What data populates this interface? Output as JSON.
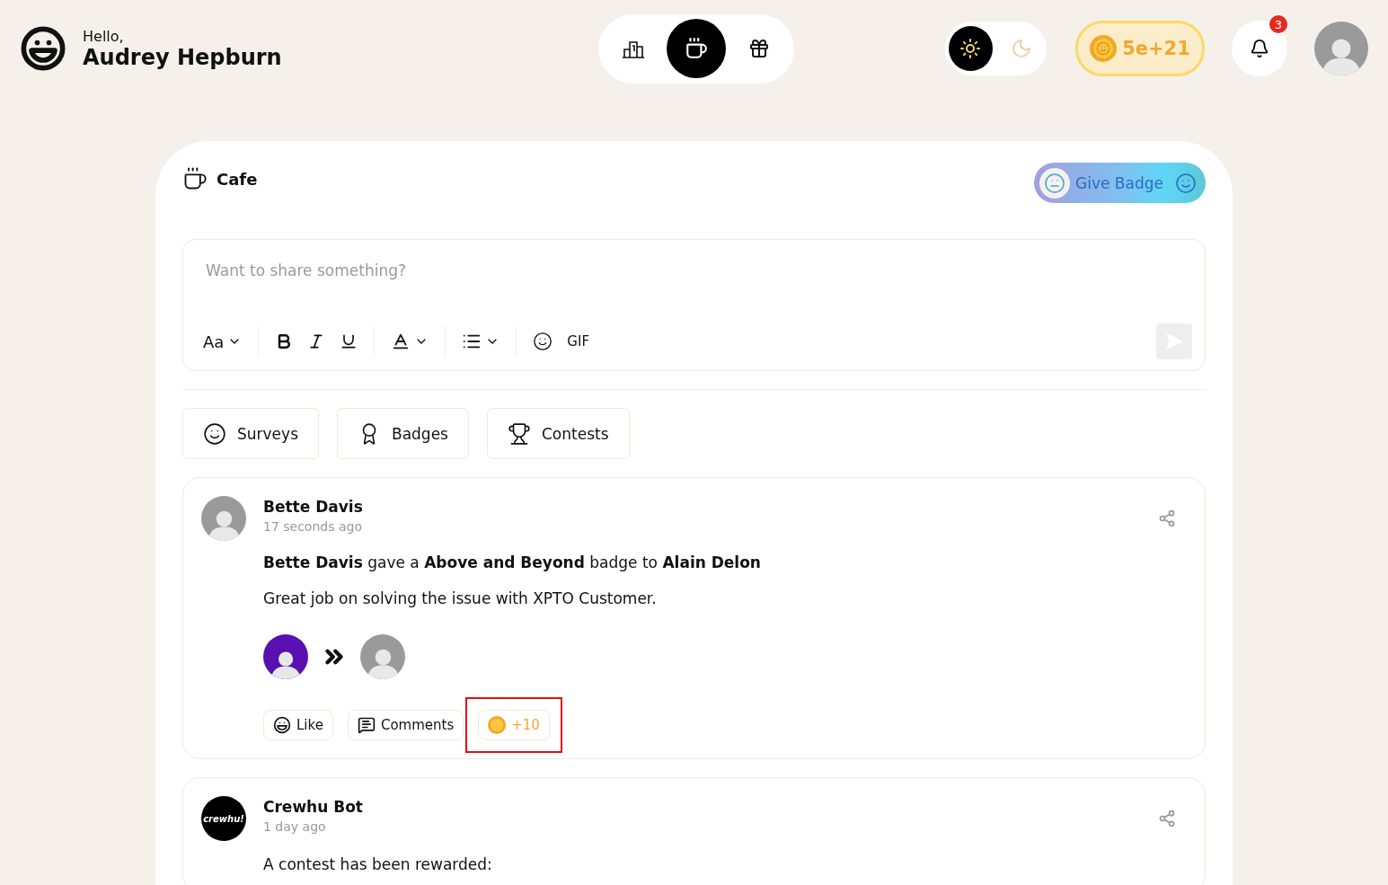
{
  "header": {
    "greeting": "Hello,",
    "user_name": "Audrey Hepburn",
    "nav": [
      {
        "kind": "leaderboard",
        "selected": false
      },
      {
        "kind": "cafe",
        "selected": true
      },
      {
        "kind": "rewards",
        "selected": false
      }
    ],
    "theme_toggle": [
      {
        "kind": "light",
        "selected": true
      },
      {
        "kind": "dark",
        "selected": false
      }
    ],
    "coins": "5e+21",
    "notifications": "3"
  },
  "feed": {
    "title": "Cafe",
    "give_badge": "Give Badge",
    "composer": {
      "placeholder": "Want to share something?",
      "font_menu": "Aa",
      "gif": "GIF"
    },
    "tabs": [
      {
        "kind": "surveys",
        "label": "Surveys"
      },
      {
        "kind": "badges",
        "label": "Badges"
      },
      {
        "kind": "contests",
        "label": "Contests"
      }
    ],
    "posts": [
      {
        "author": "Bette Davis",
        "time": "17 seconds ago",
        "kind": "badge",
        "headline": "**Bette Davis** gave a **Above and Beyond** badge to **Alain Delon**",
        "message": "Great job on solving the issue with XPTO Customer.",
        "actions": [
          {
            "kind": "like",
            "label": "Like",
            "highlighted": false
          },
          {
            "kind": "comments",
            "label": "Comments",
            "highlighted": false
          },
          {
            "kind": "coins",
            "label": "+10",
            "highlighted": true
          }
        ]
      },
      {
        "author": "Crewhu Bot",
        "time": "1 day ago",
        "kind": "bot",
        "avatar_text": "crewhu!",
        "message": "A contest has been rewarded:"
      }
    ]
  }
}
